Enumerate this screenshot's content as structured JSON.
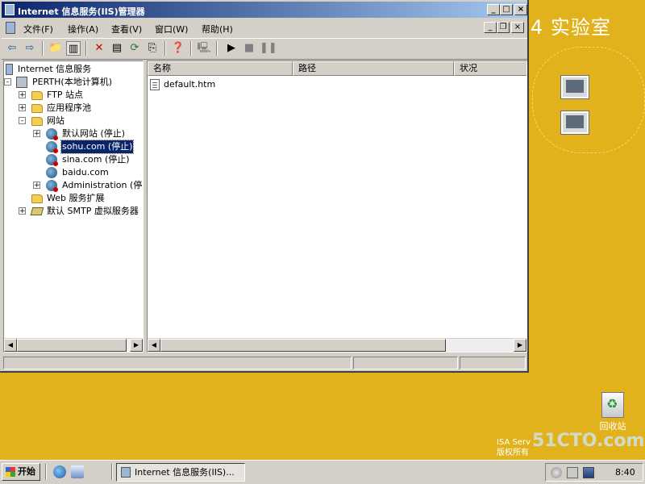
{
  "desktop": {
    "banner": "4 实验室",
    "recycle_bin": "回收站",
    "brand_logo": "51CTO.com",
    "isa_line1": "ISA Serv",
    "isa_line2": "版权所有"
  },
  "window": {
    "title": "Internet 信息服务(IIS)管理器",
    "minimize": "_",
    "maximize": "□",
    "close": "×"
  },
  "menu": {
    "items": [
      "文件(F)",
      "操作(A)",
      "查看(V)",
      "窗口(W)",
      "帮助(H)"
    ],
    "mdi_minimize": "_",
    "mdi_restore": "❐",
    "mdi_close": "×"
  },
  "toolbar": {
    "icons": [
      "back-icon",
      "forward-icon",
      "up-folder-icon",
      "show-tree-icon",
      "delete-icon",
      "properties-icon",
      "refresh-icon",
      "export-icon",
      "help-icon",
      "connect-icon",
      "start-icon",
      "stop-icon",
      "pause-icon"
    ]
  },
  "tree": {
    "nodes": [
      {
        "label": "Internet 信息服务",
        "icon": "iis-root-icon"
      },
      {
        "label": "PERTH(本地计算机)",
        "icon": "computer-icon",
        "expander": "-"
      },
      {
        "label": "FTP 站点",
        "icon": "folder-icon",
        "expander": "+"
      },
      {
        "label": "应用程序池",
        "icon": "folder-icon",
        "expander": "+"
      },
      {
        "label": "网站",
        "icon": "folder-icon",
        "expander": "-"
      },
      {
        "label": "默认网站 (停止)",
        "icon": "website-icon",
        "expander": "+"
      },
      {
        "label": "sohu.com (停止)",
        "icon": "website-icon",
        "selected": true
      },
      {
        "label": "sina.com (停止)",
        "icon": "website-icon"
      },
      {
        "label": "baidu.com",
        "icon": "website-icon"
      },
      {
        "label": "Administration (停止",
        "icon": "website-icon",
        "expander": "+"
      },
      {
        "label": "Web 服务扩展",
        "icon": "folder-icon"
      },
      {
        "label": "默认 SMTP 虚拟服务器",
        "icon": "smtp-icon",
        "expander": "+"
      }
    ]
  },
  "list": {
    "columns": [
      "名称",
      "路径",
      "状况"
    ],
    "rows": [
      {
        "name": "default.htm"
      }
    ]
  },
  "scroll": {
    "left_arrow": "◀",
    "right_arrow": "▶"
  },
  "taskbar": {
    "start_label": "开始",
    "task_label": "Internet 信息服务(IIS)...",
    "clock": "8:40"
  }
}
